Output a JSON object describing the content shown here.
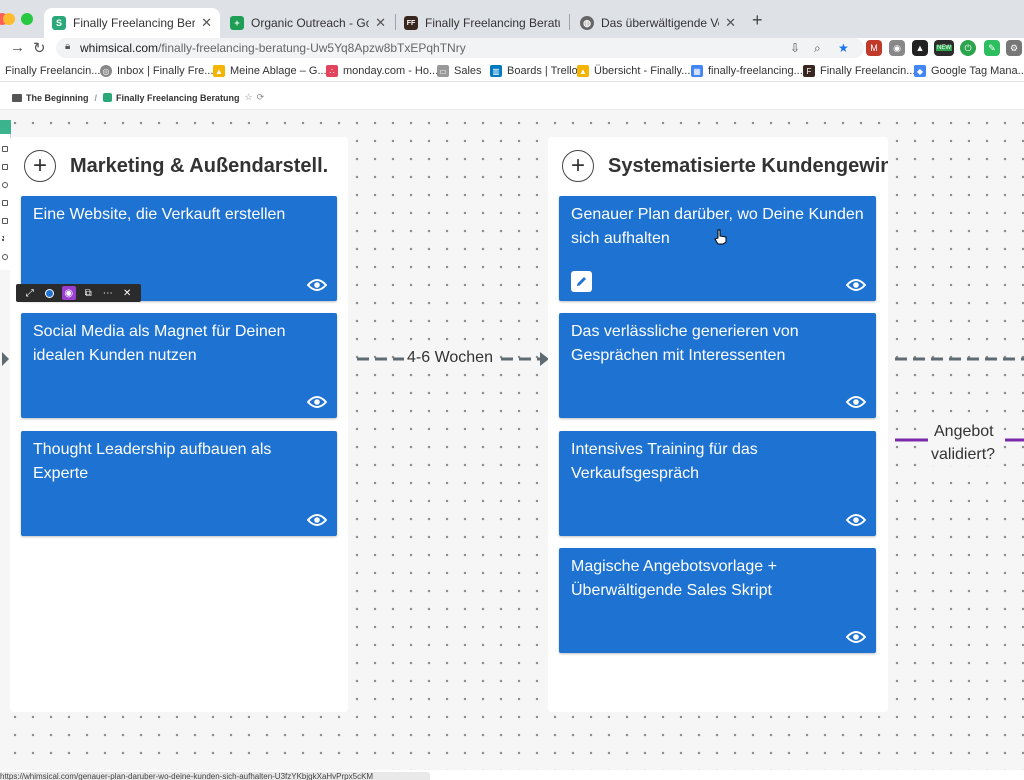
{
  "browser": {
    "tabs": [
      {
        "title": "Finally Freelancing Beratung",
        "favicon": "whimsical-icon",
        "active": true
      },
      {
        "title": "Organic Outreach - Google Tab",
        "favicon": "google-sheets-icon",
        "active": false
      },
      {
        "title": "Finally Freelancing Beratung",
        "favicon": "ff-icon",
        "active": false
      },
      {
        "title": "Das überwältigende Verkaufss",
        "favicon": "globe-icon",
        "active": false
      }
    ],
    "url_host": "whimsical.com",
    "url_path": "/finally-freelancing-beratung-Uw5Yq8Apzw8bTxEPqhTNry",
    "ext_badges": {
      "new": "NEW"
    },
    "bookmarks": [
      "Finally Freelancin...",
      "Inbox | Finally Fre...",
      "Meine Ablage – G...",
      "monday.com - Ho...",
      "Sales",
      "Boards | Trello",
      "Übersicht - Finally...",
      "finally-freelancing...",
      "Finally Freelancin...",
      "Google Tag Mana..."
    ]
  },
  "app": {
    "breadcrumb": [
      "The Beginning",
      "Finally Freelancing Beratung"
    ]
  },
  "board": {
    "columns": [
      {
        "title": "Marketing & Außendarstell.",
        "cards": [
          "Eine Website, die Verkauft erstellen",
          "Social Media als Magnet für Deinen idealen Kunden nutzen",
          "Thought Leadership aufbauen als Experte"
        ]
      },
      {
        "title": "Systematisierte Kundengewinnung",
        "cards": [
          "Genauer Plan darüber, wo Deine Kunden sich aufhalten",
          "Das verlässliche generieren von Gesprächen mit Interessenten",
          "Intensives Training für das Verkaufsgespräch",
          "Magische Angebotsvorlage + Überwältigende Sales Skript"
        ]
      }
    ],
    "connectors": {
      "timeframe": "4-6 Wochen",
      "question_line1": "Angebot",
      "question_line2": "validiert?"
    },
    "colors": {
      "card": "#1e73d2",
      "accent_purple": "#7a2aa8",
      "connector": "#5f6b73"
    }
  },
  "status_url": "https://whimsical.com/genauer-plan-daruber-wo-deine-kunden-sich-aufhalten-U3fzYKbjgkXaHvPrpx5cKM"
}
